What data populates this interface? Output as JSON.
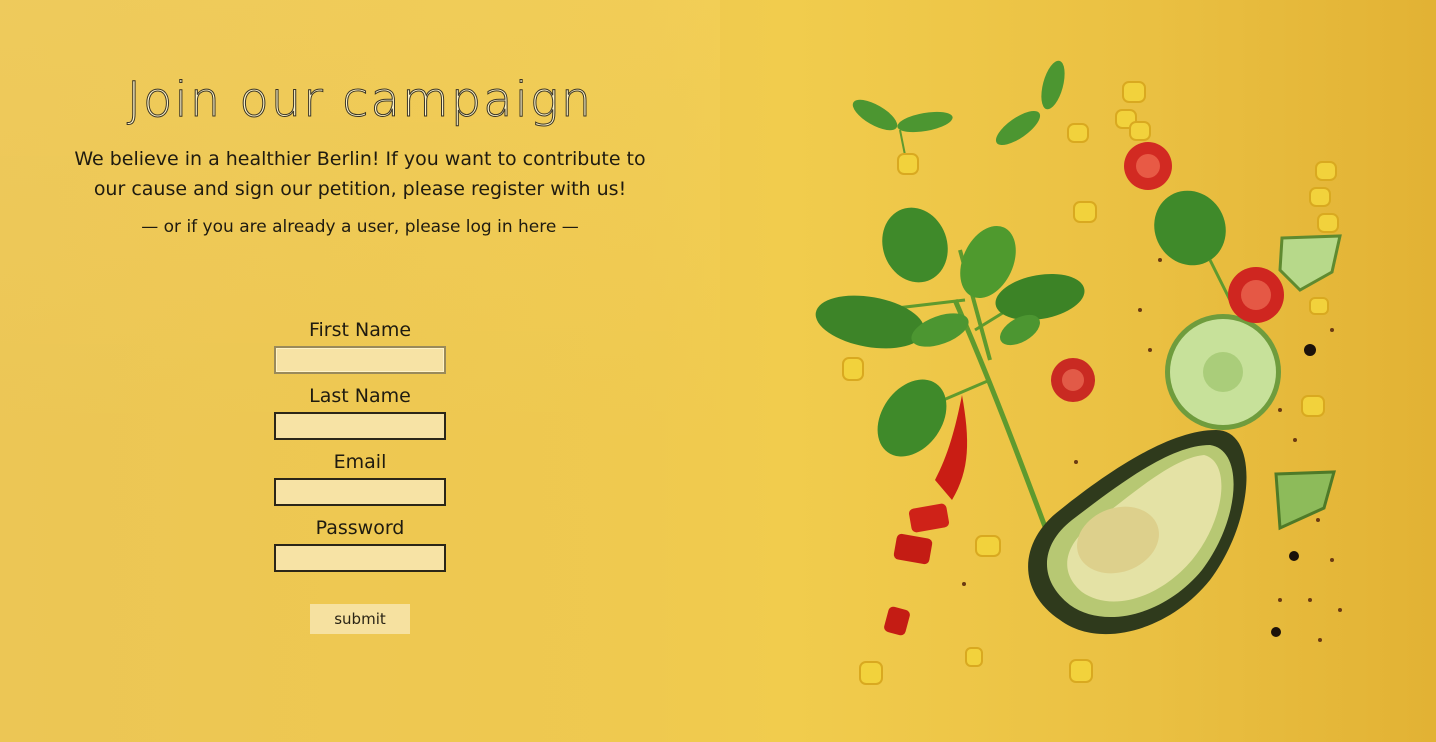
{
  "page": {
    "title": "Join our campaign",
    "lead": "We believe in a healthier Berlin! If you want to contribute to our cause and sign our petition, please register with us!",
    "login_prefix": "— or if you are already a user, please log in ",
    "login_link": "here",
    "login_suffix": " —"
  },
  "form": {
    "first_name_label": "First Name",
    "first_name_value": "",
    "last_name_label": "Last Name",
    "last_name_value": "",
    "email_label": "Email",
    "email_value": "",
    "password_label": "Password",
    "password_value": "",
    "submit_label": "submit"
  },
  "colors": {
    "background": "#efc94f",
    "input_fill": "#f7e3a5",
    "button_fill": "#f6e1a0"
  },
  "illustration": {
    "icon": "floating-vegetables-illustration"
  }
}
